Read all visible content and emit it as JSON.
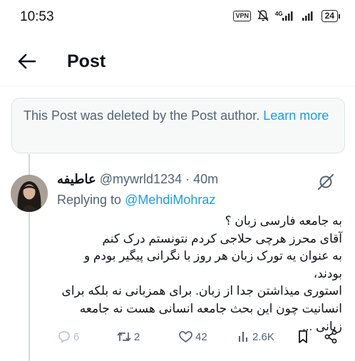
{
  "status_bar": {
    "time": "10:53",
    "vpn_label": "VPN",
    "network_label": "4G",
    "battery_level": "24"
  },
  "header": {
    "title": "Post"
  },
  "deleted_notice": {
    "text": "This Post was deleted by the Post author. ",
    "link_text": "Learn more"
  },
  "reply": {
    "display_name": "عاطیفه",
    "handle": "@mywrld1234",
    "separator": " · ",
    "time": "40m",
    "replying_prefix": "Replying to ",
    "replying_to": "@MehdiMohraz",
    "body_lines": [
      "به جامعه  فارسی زبان ؟",
      "آقای محرز هرچی حلاجی کردم نتونستم درک کنم",
      "به عنوان یه تورک زبان هر روز با نگرانی پیگیر بودم و بودند،",
      "استوری میذاشتن جدا از زبان. برای همزبانی نه بلکه  برای",
      "انسانیت چون این بحث جامعه انسانی هست نه جامعه",
      "زبانی ..."
    ],
    "stats": {
      "replies": "6",
      "reposts": "2",
      "likes": "42",
      "views": "2.6K"
    }
  },
  "colors": {
    "accent": "#1d9bf0",
    "secondary_text": "#536471",
    "notice_bg": "#f7f9f9"
  },
  "icons": [
    "back-arrow-icon",
    "grok-icon",
    "reply-icon",
    "repost-icon",
    "like-icon",
    "views-icon",
    "bookmark-icon",
    "share-icon"
  ]
}
